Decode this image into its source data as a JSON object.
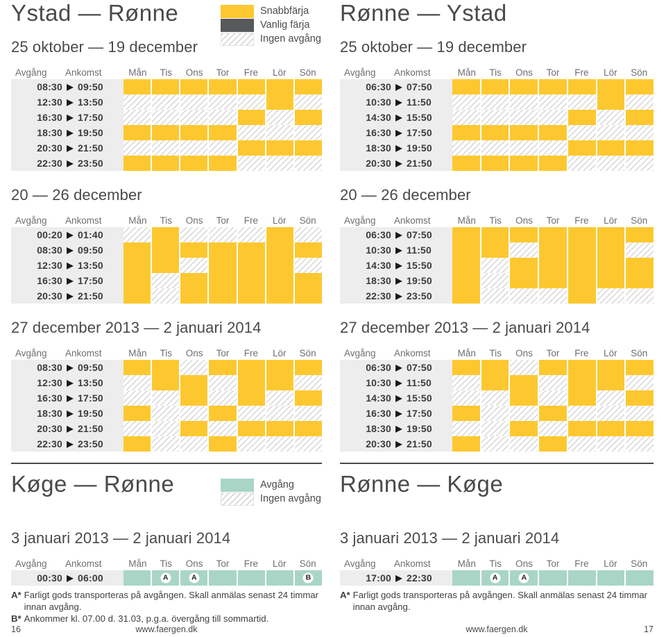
{
  "colors": {
    "departure_yellow": "#FDC82F",
    "regular_ferry_grey": "#58595B",
    "departure_teal": "#A9D5C6",
    "no_departure_hatch": "#DCDCDC",
    "time_band": "#EDEDED",
    "text": "#4A4A4A"
  },
  "day_headers": [
    "Mån",
    "Tis",
    "Ons",
    "Tor",
    "Fre",
    "Lör",
    "Sön"
  ],
  "column_headers": {
    "departure": "Avgång",
    "arrival": "Ankomst"
  },
  "arrow_glyph": "▶",
  "legends": {
    "ferry": [
      {
        "type": "yellow",
        "label": "Snabbfärja"
      },
      {
        "type": "grey",
        "label": "Vanlig färja"
      },
      {
        "type": "none",
        "label": "Ingen avgång"
      }
    ],
    "koge": [
      {
        "type": "teal",
        "label": "Avgång"
      },
      {
        "type": "none",
        "label": "Ingen avgång"
      }
    ]
  },
  "left": {
    "title": "Ystad — Rønne",
    "tables": [
      {
        "period": "25 oktober — 19 december",
        "rows": [
          {
            "dep": "08:30",
            "arr": "09:50",
            "days": [
              1,
              1,
              1,
              1,
              1,
              1,
              1
            ]
          },
          {
            "dep": "12:30",
            "arr": "13:50",
            "days": [
              0,
              0,
              0,
              0,
              0,
              1,
              0
            ]
          },
          {
            "dep": "16:30",
            "arr": "17:50",
            "days": [
              0,
              0,
              0,
              0,
              1,
              0,
              1
            ]
          },
          {
            "dep": "18:30",
            "arr": "19:50",
            "days": [
              1,
              1,
              1,
              1,
              0,
              0,
              0
            ]
          },
          {
            "dep": "20:30",
            "arr": "21:50",
            "days": [
              0,
              0,
              0,
              0,
              1,
              1,
              1
            ]
          },
          {
            "dep": "22:30",
            "arr": "23:50",
            "days": [
              1,
              1,
              1,
              1,
              0,
              0,
              0
            ]
          }
        ]
      },
      {
        "period": "20 — 26 december",
        "rows": [
          {
            "dep": "00:20",
            "arr": "01:40",
            "days": [
              0,
              1,
              0,
              0,
              0,
              1,
              0
            ]
          },
          {
            "dep": "08:30",
            "arr": "09:50",
            "days": [
              1,
              1,
              1,
              1,
              1,
              1,
              1
            ]
          },
          {
            "dep": "12:30",
            "arr": "13:50",
            "days": [
              1,
              1,
              0,
              1,
              1,
              1,
              0
            ]
          },
          {
            "dep": "16:30",
            "arr": "17:50",
            "days": [
              1,
              0,
              1,
              1,
              1,
              1,
              1
            ]
          },
          {
            "dep": "20:30",
            "arr": "21:50",
            "days": [
              1,
              0,
              1,
              1,
              1,
              1,
              1
            ]
          }
        ]
      },
      {
        "period": "27 december 2013 — 2 januari 2014",
        "rows": [
          {
            "dep": "08:30",
            "arr": "09:50",
            "days": [
              1,
              1,
              0,
              1,
              1,
              1,
              1
            ]
          },
          {
            "dep": "12:30",
            "arr": "13:50",
            "days": [
              0,
              1,
              1,
              0,
              1,
              1,
              0
            ]
          },
          {
            "dep": "16:30",
            "arr": "17:50",
            "days": [
              0,
              0,
              1,
              0,
              1,
              0,
              1
            ]
          },
          {
            "dep": "18:30",
            "arr": "19:50",
            "days": [
              1,
              0,
              0,
              1,
              0,
              0,
              0
            ]
          },
          {
            "dep": "20:30",
            "arr": "21:50",
            "days": [
              0,
              0,
              1,
              0,
              1,
              1,
              1
            ]
          },
          {
            "dep": "22:30",
            "arr": "23:50",
            "days": [
              1,
              0,
              0,
              1,
              0,
              0,
              0
            ]
          }
        ]
      }
    ],
    "koge": {
      "title": "Køge — Rønne",
      "period": "3 januari 2013 — 2 januari 2014",
      "rows": [
        {
          "dep": "00:30",
          "arr": "06:00",
          "days": [
            1,
            1,
            1,
            1,
            1,
            1,
            1
          ],
          "badges": [
            "",
            "A",
            "A",
            "",
            "",
            "",
            "B"
          ]
        }
      ],
      "notes": [
        {
          "key": "A*",
          "text": "Farligt gods transporteras på avgången. Skall anmälas senast 24 timmar innan avgång."
        },
        {
          "key": "B*",
          "text": "Ankommer kl. 07.00 d. 31.03, p.g.a. övergång till sommartid."
        }
      ]
    },
    "footer": {
      "page": "16",
      "url": "www.faergen.dk"
    }
  },
  "right": {
    "title": "Rønne — Ystad",
    "tables": [
      {
        "period": "25 oktober — 19 december",
        "rows": [
          {
            "dep": "06:30",
            "arr": "07:50",
            "days": [
              1,
              1,
              1,
              1,
              1,
              1,
              1
            ]
          },
          {
            "dep": "10:30",
            "arr": "11:50",
            "days": [
              0,
              0,
              0,
              0,
              0,
              1,
              0
            ]
          },
          {
            "dep": "14:30",
            "arr": "15:50",
            "days": [
              0,
              0,
              0,
              0,
              1,
              0,
              1
            ]
          },
          {
            "dep": "16:30",
            "arr": "17:50",
            "days": [
              1,
              1,
              1,
              1,
              0,
              0,
              0
            ]
          },
          {
            "dep": "18:30",
            "arr": "19:50",
            "days": [
              0,
              0,
              0,
              0,
              1,
              1,
              1
            ]
          },
          {
            "dep": "20:30",
            "arr": "21:50",
            "days": [
              1,
              1,
              1,
              1,
              0,
              0,
              0
            ]
          }
        ]
      },
      {
        "period": "20 — 26 december",
        "rows": [
          {
            "dep": "06:30",
            "arr": "07:50",
            "days": [
              1,
              1,
              1,
              1,
              1,
              1,
              1
            ]
          },
          {
            "dep": "10:30",
            "arr": "11:50",
            "days": [
              1,
              1,
              0,
              1,
              1,
              1,
              0
            ]
          },
          {
            "dep": "14:30",
            "arr": "15:50",
            "days": [
              1,
              0,
              1,
              1,
              1,
              1,
              1
            ]
          },
          {
            "dep": "18:30",
            "arr": "19:50",
            "days": [
              1,
              0,
              1,
              1,
              1,
              1,
              1
            ]
          },
          {
            "dep": "22:30",
            "arr": "23:50",
            "days": [
              1,
              0,
              0,
              0,
              1,
              0,
              0
            ]
          }
        ]
      },
      {
        "period": "27 december 2013 — 2 januari 2014",
        "rows": [
          {
            "dep": "06:30",
            "arr": "07:50",
            "days": [
              1,
              1,
              0,
              1,
              1,
              1,
              1
            ]
          },
          {
            "dep": "10:30",
            "arr": "11:50",
            "days": [
              0,
              1,
              1,
              0,
              1,
              1,
              0
            ]
          },
          {
            "dep": "14:30",
            "arr": "15:50",
            "days": [
              0,
              0,
              1,
              0,
              1,
              0,
              1
            ]
          },
          {
            "dep": "16:30",
            "arr": "17:50",
            "days": [
              1,
              0,
              0,
              1,
              0,
              0,
              0
            ]
          },
          {
            "dep": "18:30",
            "arr": "19:50",
            "days": [
              0,
              0,
              1,
              0,
              1,
              1,
              1
            ]
          },
          {
            "dep": "20:30",
            "arr": "21:50",
            "days": [
              1,
              0,
              0,
              1,
              0,
              0,
              0
            ]
          }
        ]
      }
    ],
    "koge": {
      "title": "Rønne — Køge",
      "period": "3 januari 2013 — 2 januari 2014",
      "rows": [
        {
          "dep": "17:00",
          "arr": "22:30",
          "days": [
            1,
            1,
            1,
            1,
            1,
            1,
            1
          ],
          "badges": [
            "",
            "A",
            "A",
            "",
            "",
            "",
            ""
          ]
        }
      ],
      "notes": [
        {
          "key": "A*",
          "text": "Farligt gods transporteras på avgången. Skall anmälas senast 24 timmar innan avgång."
        }
      ]
    },
    "footer": {
      "page": "17",
      "url": "www.faergen.dk"
    }
  }
}
